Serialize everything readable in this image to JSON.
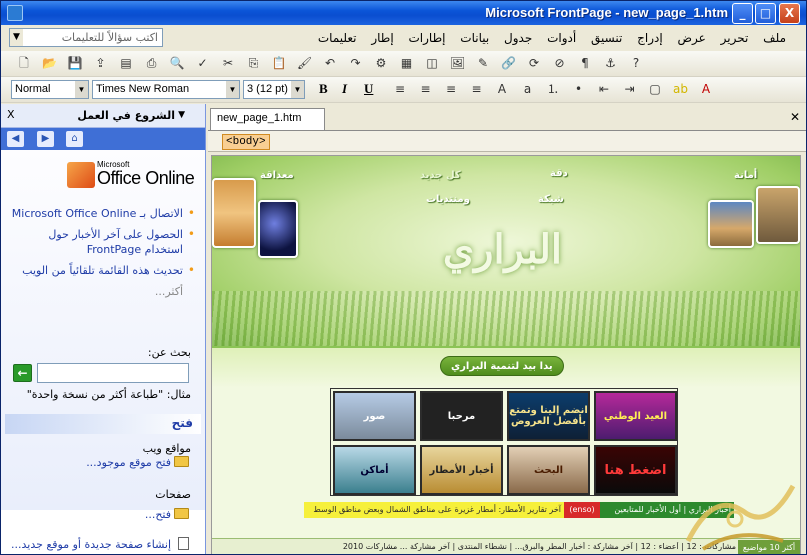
{
  "window": {
    "title": "Microsoft FrontPage - new_page_1.htm",
    "controls": {
      "minimize": "_",
      "maximize": "□",
      "close": "X"
    }
  },
  "menubar": {
    "items": [
      "ملف",
      "تحرير",
      "عرض",
      "إدراج",
      "تنسيق",
      "أدوات",
      "جدول",
      "بيانات",
      "إطارات",
      "إطار",
      "تعليمات"
    ],
    "help_placeholder": "اكتب سؤالاً للتعليمات"
  },
  "toolbar_format": {
    "style": "Normal",
    "font": "Times New Roman",
    "size": "3 (12 pt)",
    "bold": "B",
    "italic": "I",
    "underline": "U"
  },
  "taskpane": {
    "title": "الشروع في العمل",
    "close": "X",
    "logo_small": "Microsoft",
    "logo_text": "Office Online",
    "links": [
      "الاتصال بـ Microsoft Office Online",
      "الحصول على آخر الأخبار حول استخدام FrontPage",
      "تحديث هذه القائمة تلقائياً من الويب",
      "أكثر..."
    ],
    "search_label": "بحث عن:",
    "search_value": "",
    "example": "مثال: \"طباعة أكثر من نسخة واحدة\"",
    "open_heading": "فتح",
    "websites_label": "مواقع ويب",
    "open_site": "فتح موقع موجود...",
    "pages_label": "صفحات",
    "open_page": "فتح...",
    "new_page": "إنشاء صفحة جديدة أو موقع جديد..."
  },
  "document": {
    "tab": "new_page_1.htm",
    "tag": "<body>",
    "banner_words": [
      "أمانة",
      "معداقة",
      "دقة",
      "كل جديد",
      "شبكة",
      "ومنتديات"
    ],
    "banner_logo": "البراري",
    "slogan": "يدا بيد لتنمية البراري",
    "ads": [
      "اضغط هنا",
      "أخبار الأمطار",
      "البحث",
      "أماكن",
      "العيد الوطني",
      "انضم إلينا وتمتع بأفضل العروض",
      "مرحبا",
      "صور"
    ],
    "ticker_main": "آخر تقارير الأمطار: أمطار غزيرة على مناطق الشمال وبعض مناطق الوسط",
    "ticker_red": "(enso)",
    "ticker_green": "أخبار البراري | أول الأخبار للمتابعين",
    "stats_text": "مشاركات : 12 | أعضاء : 12 | آخر مشاركة : أخبار المطر والبرق... | نشطاء المنتدى | آخر مشاركة ... مشاركات 2010",
    "top10": "أكثر 10 مواضيع"
  },
  "colors": {
    "titlebar": "#0b55d8",
    "taskpane_nav": "#3f6fd6",
    "banner_green": "#9fce65"
  }
}
